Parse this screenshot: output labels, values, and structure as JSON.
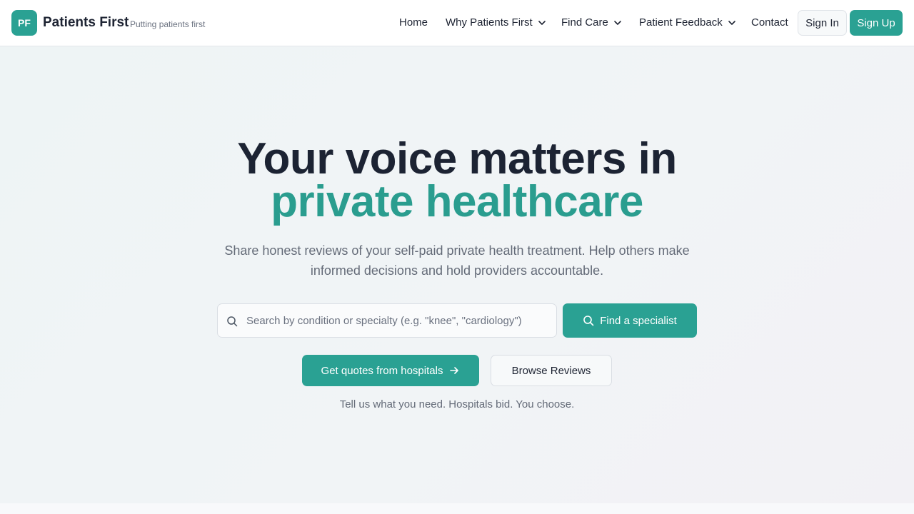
{
  "brand": {
    "logo_initials": "PF",
    "name": "Patients First",
    "tagline": "Putting patients first"
  },
  "nav": {
    "items": [
      {
        "label": "Home"
      },
      {
        "label": "Why Patients First",
        "dropdown": true
      },
      {
        "label": "Find Care",
        "dropdown": true
      },
      {
        "label": "Patient Feedback",
        "dropdown": true
      },
      {
        "label": "Contact"
      }
    ],
    "sign_in": "Sign In",
    "sign_up": "Sign Up"
  },
  "hero": {
    "title_line1": "Your voice matters in",
    "title_line2": "private healthcare",
    "subtitle": "Share honest reviews of your self-paid private health treatment. Help others make informed decisions and hold providers accountable.",
    "search_placeholder": "Search by condition or specialty (e.g. \"knee\", \"cardiology\")",
    "search_value": "",
    "find_button": "Find a specialist",
    "quotes_button": "Get quotes from hospitals",
    "browse_button": "Browse Reviews",
    "tagline": "Tell us what you need. Hospitals bid. You choose."
  },
  "colors": {
    "accent": "#2aa193",
    "accent_text": "#2a9d8f",
    "heading": "#1c2333",
    "muted": "#646b78"
  },
  "icons": {
    "search": "search-icon",
    "dropdown": "chevron-down-icon",
    "arrow": "arrow-right-icon"
  }
}
